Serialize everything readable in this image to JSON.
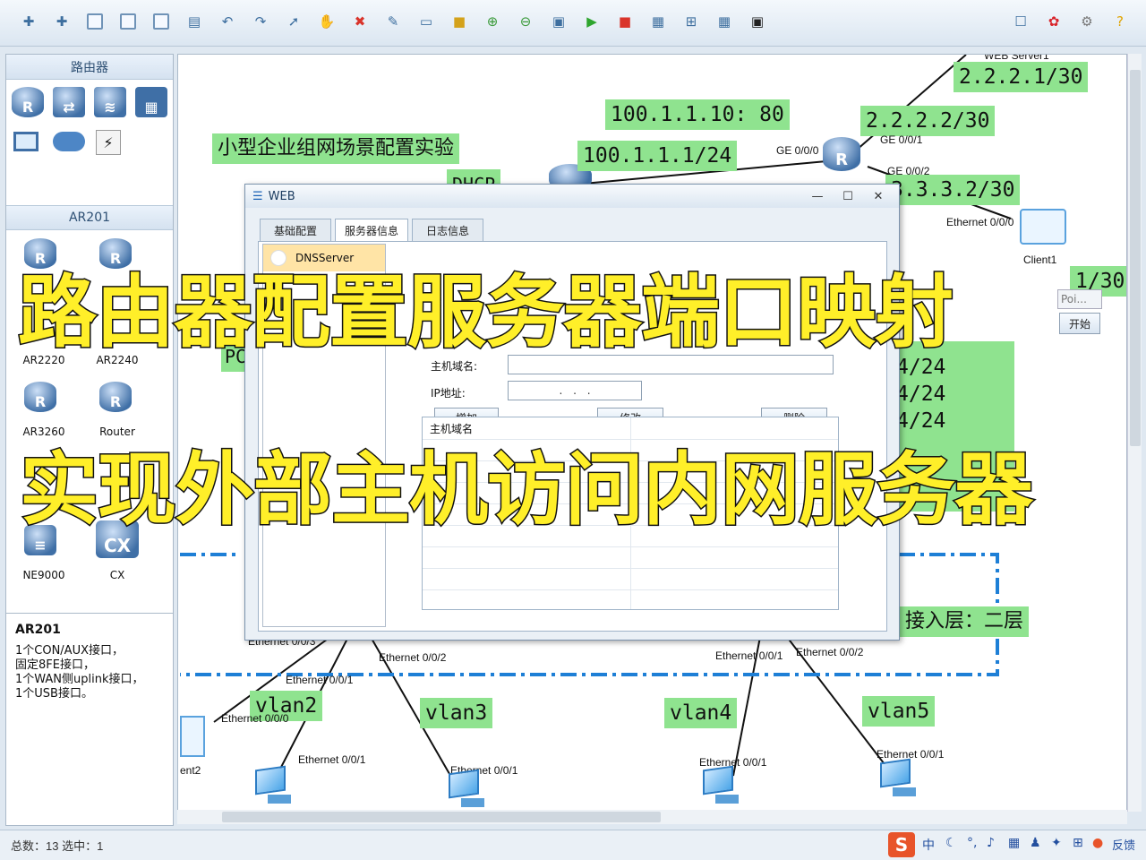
{
  "toolbar": {
    "icons": [
      "new-topology-icon",
      "new-file-icon",
      "open-icon",
      "save-icon",
      "save-as-icon",
      "print-icon",
      "undo-icon",
      "redo-icon",
      "select-icon",
      "hand-icon",
      "delete-icon",
      "clear-icon",
      "text-label-icon",
      "rectangle-icon",
      "zoom-in-icon",
      "zoom-out-icon",
      "fit-icon",
      "start-all-icon",
      "stop-all-icon",
      "capture-icon",
      "topology-icon",
      "grid-icon",
      "screenshot-icon"
    ],
    "right_icons": [
      "chat-icon",
      "huawei-logo-icon",
      "settings-icon",
      "help-icon"
    ]
  },
  "sidebar": {
    "section1_title": "路由器",
    "section2_title": "AR201",
    "device_labels": [
      "AR2220",
      "AR2240",
      "AR3260",
      "Router",
      "NE9000",
      "CX"
    ],
    "cx_icon_text": "CX"
  },
  "description": {
    "title": "AR201",
    "lines": [
      "1个CON/AUX接口，",
      "固定8FE接口，",
      "1个WAN侧uplink接口，",
      "1个USB接口。"
    ]
  },
  "topology": {
    "title_label": "小型企业组网场景配置实验",
    "labels": {
      "ip_2221": "2.2.2.1/30",
      "nat_server": "100.1.1.10: 80",
      "ip_2222": "2.2.2.2/30",
      "ip_1001": "100.1.1.1/24",
      "ip_3332": "3.3.3.2/30",
      "dhcp": "DHCP",
      "web_server": "WEB Server1",
      "client_ip_tail": "1/30",
      "net_a": "4/24",
      "net_b": "4/24",
      "net_c": "4/24",
      "access_layer": "接入层：二层",
      "vlan2": "vlan2",
      "vlan3": "vlan3",
      "vlan4": "vlan4",
      "vlan5": "vlan5",
      "pc_partial": "PC",
      "client2_partial": "ent2"
    },
    "interfaces": {
      "ge000": "GE 0/0/0",
      "ge001": "GE 0/0/1",
      "ge002": "GE 0/0/2",
      "eth000_client": "Ethernet 0/0/0",
      "client1": "Client1",
      "eth003": "Ethernet 0/0/3",
      "eth002_left": "Ethernet 0/0/2",
      "eth001_left": "Ethernet 0/0/1",
      "eth000_left": "Ethernet 0/0/0",
      "eth001_pc1": "Ethernet 0/0/1",
      "eth001_pc2": "Ethernet 0/0/1",
      "eth001_right": "Ethernet 0/0/1",
      "eth002_right": "Ethernet 0/0/2",
      "eth001_pc3": "Ethernet 0/0/1",
      "eth001_pc4": "Ethernet 0/0/1"
    },
    "popup": {
      "text": "Poi...",
      "start_button": "开始"
    }
  },
  "dialog": {
    "title": "WEB",
    "tabs": [
      "基础配置",
      "服务器信息",
      "日志信息"
    ],
    "service_item": "DNSServer",
    "host_label": "主机域名:",
    "ip_label": "IP地址:",
    "ip_placeholder": ".       .       .",
    "add_button": "增加",
    "modify_button": "修改",
    "delete_button": "删除",
    "table_header": "主机域名"
  },
  "caption": {
    "line1": "路由器配置服务器端口映射",
    "line2": "实现外部主机访问内网服务器"
  },
  "status": {
    "text": "总数：13  选中：1",
    "ime": "中",
    "tray_tail": "反馈"
  },
  "colors": {
    "label_green": "#8fe38f",
    "caption_yellow": "#ffef29",
    "dash_blue": "#1e7fd6"
  }
}
